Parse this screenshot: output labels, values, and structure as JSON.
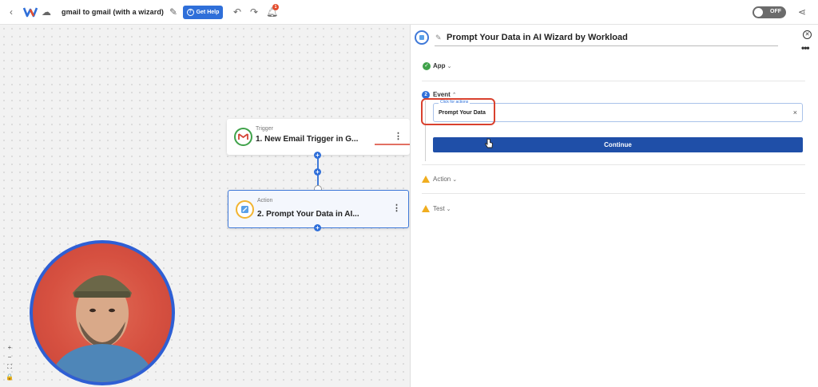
{
  "topbar": {
    "workflow_title": "gmail to gmail (with a wizard)",
    "help_label": "Get Help",
    "notification_count": "1",
    "toggle_label": "OFF"
  },
  "canvas": {
    "trigger": {
      "kind": "Trigger",
      "name": "1. New Email Trigger in G..."
    },
    "action": {
      "kind": "Action",
      "name": "2. Prompt Your Data in AI..."
    },
    "zoom_controls": [
      "+",
      "−",
      "⛶",
      "🔒"
    ]
  },
  "panel": {
    "title": "Prompt Your Data in AI Wizard by Workload",
    "sections": {
      "app": {
        "label": "App",
        "status": "complete"
      },
      "event": {
        "label": "Event",
        "step": "2"
      },
      "action": {
        "label": "Action",
        "status": "warning"
      },
      "test": {
        "label": "Test",
        "status": "warning"
      }
    },
    "event_field": {
      "label": "Click for actions",
      "value": "Prompt Your Data"
    },
    "continue_label": "Continue"
  },
  "colors": {
    "primary": "#2f6fd9",
    "continue": "#1f4fa8",
    "highlight": "#d9412e",
    "warning": "#f0ad1f",
    "success": "#3fa24a"
  },
  "icons": [
    "back-icon",
    "workload-logo-icon",
    "cloud-icon",
    "pencil-icon",
    "help-icon",
    "undo-icon",
    "redo-icon",
    "bell-icon",
    "share-icon",
    "gmail-icon",
    "ai-wizard-icon",
    "close-icon",
    "more-icon"
  ]
}
